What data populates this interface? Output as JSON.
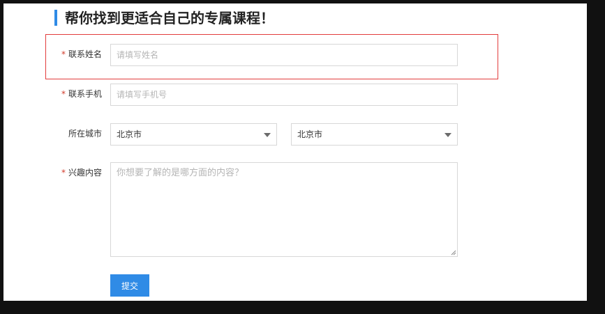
{
  "form": {
    "title": "帮你找到更适合自己的专属课程！",
    "required_mark": "*",
    "name": {
      "label": "联系姓名",
      "placeholder": "请填写姓名"
    },
    "phone": {
      "label": "联系手机",
      "placeholder": "请填写手机号"
    },
    "city": {
      "label": "所在城市",
      "province_value": "北京市",
      "city_value": "北京市"
    },
    "interest": {
      "label": "兴趣内容",
      "placeholder": "你想要了解的是哪方面的内容？"
    },
    "submit_label": "提交"
  },
  "colors": {
    "accent": "#2f8be6",
    "required": "#d23b2b",
    "highlight_border": "#e23c3c",
    "page_background": "#111111"
  }
}
